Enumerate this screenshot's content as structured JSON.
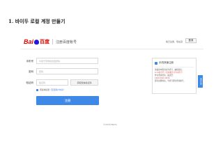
{
  "heading": "1. 바이두 로컬 계정 만들기",
  "logo": {
    "bai": "Bai",
    "du_cn": "百度",
    "page_title": "注册百度帐号"
  },
  "top_right": {
    "prompt": "我已注册，现在就",
    "login_button": "登录"
  },
  "form": {
    "phone": {
      "label": "手机号",
      "placeholder": "可用于登录和找回密码"
    },
    "password": {
      "label": "密码",
      "placeholder": "密码"
    },
    "code": {
      "label": "验证码",
      "placeholder": "验证码",
      "button": "获取短信验证码"
    },
    "agree": {
      "text": "阅读并接受",
      "link": "《百度用户协议》"
    },
    "submit": "注册"
  },
  "side_panel": {
    "title": "手机快速注册",
    "line1": "请使用中国大陆手机号，编辑短信：",
    "line2": "6-14位字符（支持数字/字母/符号）",
    "line3": "作为登录密码，发送至：",
    "line4": "1069 0691 0036",
    "line5": "即可注册成功，手机号即为登录帐号。",
    "tab": "意见反馈"
  },
  "footer": "©2018 Baidu",
  "colors": {
    "accent": "#3e88e8",
    "brand_red": "#e10601",
    "warn": "#e84c3d"
  }
}
